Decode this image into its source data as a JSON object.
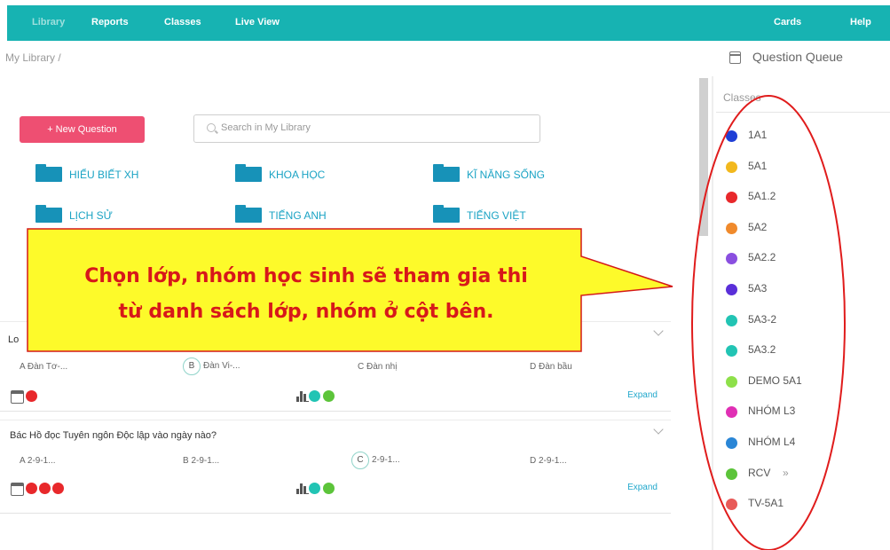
{
  "nav": {
    "items": [
      "Library",
      "Reports",
      "Classes",
      "Live View"
    ],
    "right": [
      "Cards",
      "Help"
    ]
  },
  "breadcrumb": "My Library /",
  "new_question_label": "+ New Question",
  "search": {
    "placeholder": "Search in My Library"
  },
  "folders": [
    "HIỂU BIẾT XH",
    "KHOA HỌC",
    "KĨ NĂNG SỐNG",
    "LỊCH SỬ",
    "TIẾNG ANH",
    "TIẾNG VIỆT"
  ],
  "callout": {
    "line1": "Chọn lớp, nhóm học sinh sẽ tham gia thi",
    "line2": "từ danh sách lớp, nhóm ở cột bên."
  },
  "cards": [
    {
      "title": "Lo",
      "options": [
        "A  Đàn Tơ-...",
        "B",
        "Đàn Vi-...",
        "C  Đàn nhị",
        "D  Đàn bầu"
      ],
      "expand": "Expand"
    },
    {
      "title": "Bác Hồ đọc Tuyên ngôn Độc lập vào ngày nào?",
      "options": [
        "A  2-9-1...",
        "B  2-9-1...",
        "C",
        "2-9-1...",
        "D  2-9-1..."
      ],
      "expand": "Expand"
    }
  ],
  "queue": {
    "title": "Question Queue",
    "classes_label": "Classes",
    "classes": [
      {
        "name": "1A1",
        "color": "#1f3fd6"
      },
      {
        "name": "5A1",
        "color": "#f2b81d"
      },
      {
        "name": "5A1.2",
        "color": "#e8282b"
      },
      {
        "name": "5A2",
        "color": "#f08a2c"
      },
      {
        "name": "5A2.2",
        "color": "#8a4fe0"
      },
      {
        "name": "5A3",
        "color": "#5a2fd9"
      },
      {
        "name": "5A3-2",
        "color": "#22c4b4"
      },
      {
        "name": "5A3.2",
        "color": "#22c4b4"
      },
      {
        "name": "DEMO 5A1",
        "color": "#8ee04a"
      },
      {
        "name": "NHÓM L3",
        "color": "#e02fb4"
      },
      {
        "name": "NHÓM L4",
        "color": "#2a86d6"
      },
      {
        "name": "RCV",
        "color": "#5cc43a"
      },
      {
        "name": "TV-5A1",
        "color": "#e85a58"
      }
    ],
    "rcv_chevron": "»"
  }
}
